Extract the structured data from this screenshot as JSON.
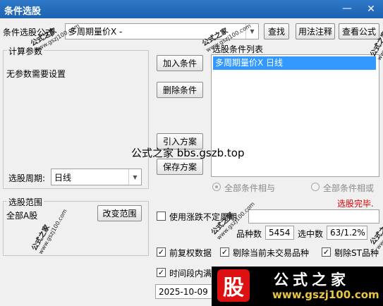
{
  "window": {
    "title": "条件选股",
    "minimize_glyph": "—",
    "close_glyph": "✕"
  },
  "top": {
    "formula_label": "条件选股公式",
    "formula_value": "多周期量价X  -",
    "find_label": "查找",
    "usage_label": "用法注释",
    "view_formula_label": "查看公式"
  },
  "params": {
    "group_label": "计算参数",
    "no_params_text": "无参数需要设置",
    "period_label": "选股周期:",
    "period_value": "日线"
  },
  "actions": {
    "add_condition": "加入条件",
    "delete_condition": "删除条件",
    "import_plan": "引入方案",
    "save_plan": "保存方案"
  },
  "conditions": {
    "list_label": "选股条件列表",
    "items": [
      "多周期量价X  日线"
    ],
    "all_and_label": "全部条件相与",
    "all_or_label": "全部条件相或",
    "status_text": "选股完毕."
  },
  "scope": {
    "group_label": "选股范围",
    "value": "全部A股",
    "change_label": "改变范围"
  },
  "options": {
    "use_limit_label": "使用涨跌不定周期",
    "count_label": "品种数",
    "count_value": "5454",
    "selected_label": "选中数",
    "selected_value": "63/1.2%",
    "pre_adjust_label": "前复权数据",
    "exclude_untraded_label": "剔除当前未交易品种",
    "exclude_st_label": "剔除ST品种",
    "time_range_label": "时间段内满",
    "date_value": "2025-10-09"
  },
  "overlay": {
    "caption": "公式之家 bbs.gszb.top",
    "watermark_text": "公式之家",
    "watermark_url": "www.gszj100.com"
  },
  "banner": {
    "logo_char": "股",
    "title": "公式之家",
    "url": "www.gszj100.com"
  },
  "colors": {
    "titlebar": "#1d62b0",
    "selection": "#3399ff",
    "status_red": "#e00000"
  }
}
